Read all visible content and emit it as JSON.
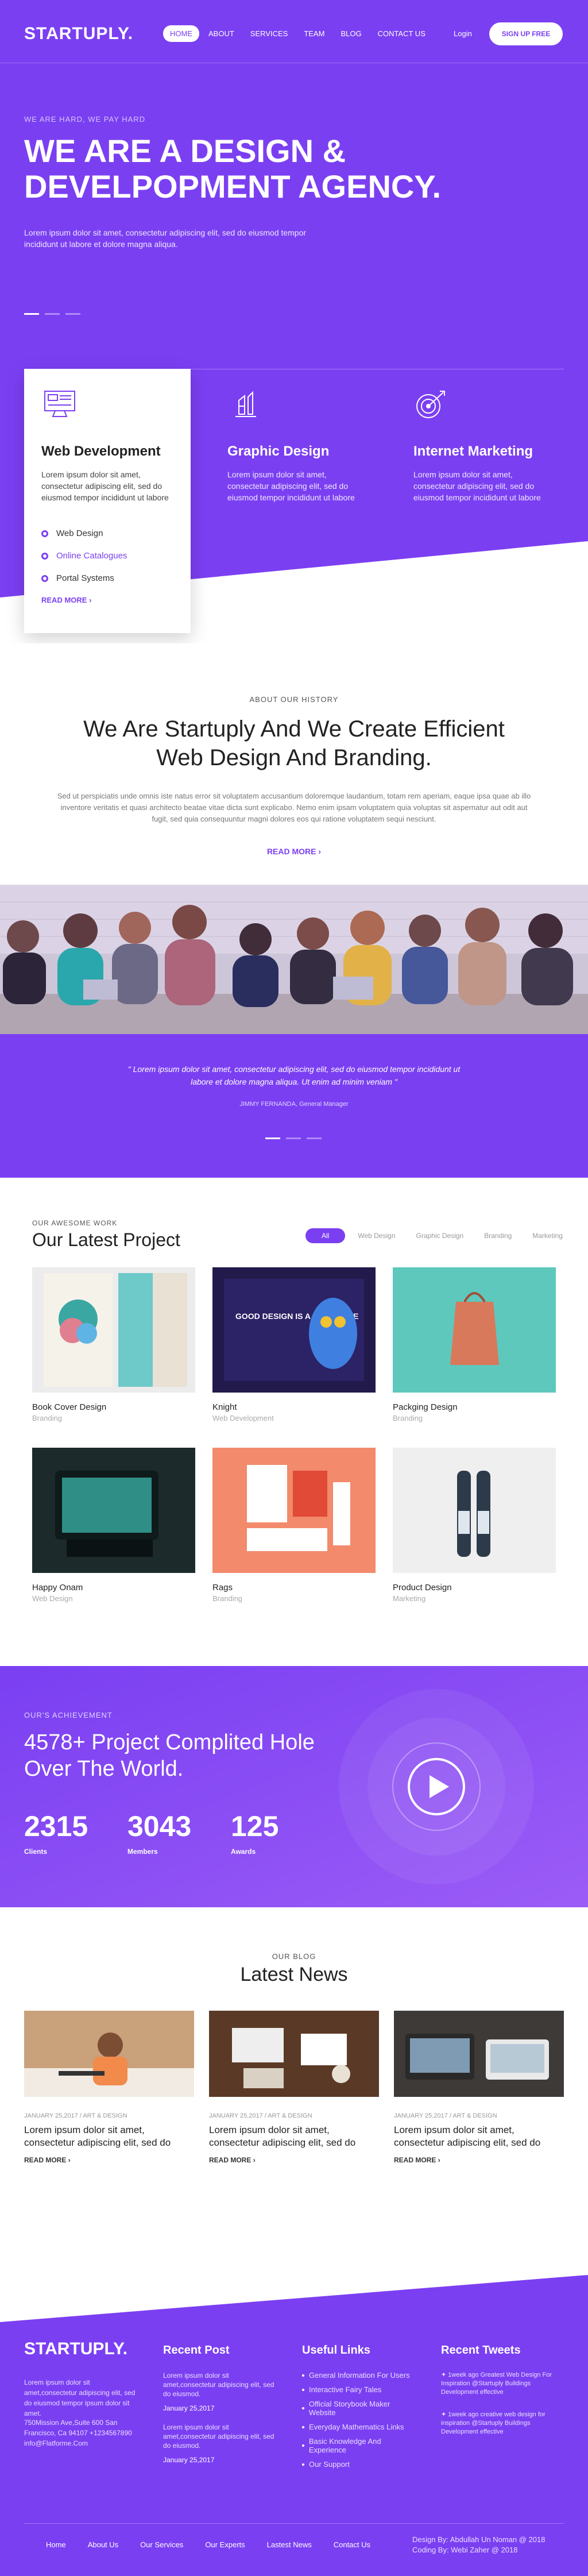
{
  "header": {
    "logo": "STARTUPLY.",
    "nav": [
      "HOME",
      "ABOUT",
      "SERVICES",
      "TEAM",
      "BLOG",
      "CONTACT US"
    ],
    "login": "Login",
    "signup": "SIGN UP FREE"
  },
  "hero": {
    "kicker": "WE ARE HARD, WE PAY HARD",
    "title": "WE ARE A DESIGN & DEVELPOPMENT AGENCY.",
    "lead": "Lorem ipsum dolor sit amet, consectetur adipiscing elit, sed do eiusmod tempor incididunt ut labore et dolore magna aliqua."
  },
  "services": [
    {
      "title": "Web Development",
      "text": "Lorem ipsum dolor sit amet, consectetur adipiscing elit, sed do eiusmod tempor incididunt ut labore",
      "icon": "monitor-code-icon"
    },
    {
      "title": "Graphic Design",
      "text": "Lorem ipsum dolor sit amet, consectetur adipiscing elit, sed do eiusmod tempor incididunt ut labore",
      "icon": "pen-tools-icon"
    },
    {
      "title": "Internet Marketing",
      "text": "Lorem ipsum dolor sit amet, consectetur adipiscing elit, sed do eiusmod tempor incididunt ut labore",
      "icon": "target-icon"
    }
  ],
  "service_list": [
    "Web Design",
    "Online Catalogues",
    "Portal Systems"
  ],
  "service_more": "READ MORE",
  "about": {
    "kicker": "ABOUT OUR HISTORY",
    "title": "We Are Startuply And We Create Efficient Web Design And Branding.",
    "text": "Sed ut perspiciatis unde omnis iste natus error sit voluptatem accusantium doloremque laudantium, totam rem aperiam, eaque ipsa quae ab illo inventore veritatis et quasi architecto beatae vitae dicta sunt explicabo. Nemo enim ipsam voluptatem quia voluptas sit aspernatur aut odit aut fugit, sed quia consequuntur magni dolores eos qui ratione voluptatem sequi nesciunt.",
    "more": "READ MORE"
  },
  "testimonial": {
    "quote": "\" Lorem ipsum dolor sit amet, consectetur adipiscing elit, sed do eiusmod tempor incididunt ut labore et dolore magna aliqua. Ut enim ad minim veniam \"",
    "author": "JIMMY FERNANDA, General Manager"
  },
  "projects": {
    "kicker": "OUR AWESOME WORK",
    "title": "Our Latest Project",
    "filters": [
      "All",
      "Web Design",
      "Graphic Design",
      "Branding",
      "Marketing"
    ],
    "items": [
      {
        "title": "Book Cover Design",
        "tag": "Branding"
      },
      {
        "title": "Knight",
        "tag": "Web Development"
      },
      {
        "title": "Packging Design",
        "tag": "Branding"
      },
      {
        "title": "Happy Onam",
        "tag": "Web Design"
      },
      {
        "title": "Rags",
        "tag": "Branding"
      },
      {
        "title": "Product Design",
        "tag": "Marketing"
      }
    ],
    "knight_card_text": "GOOD DESIGN IS A LANGUAGE"
  },
  "achievement": {
    "kicker": "OUR'S ACHIEVEMENT",
    "title": "4578+ Project Complited Hole Over The World.",
    "stats": [
      {
        "value": "2315",
        "label": "Clients"
      },
      {
        "value": "3043",
        "label": "Members"
      },
      {
        "value": "125",
        "label": "Awards"
      }
    ]
  },
  "blog": {
    "kicker": "OUR BLOG",
    "title": "Latest News",
    "posts": [
      {
        "meta": "JANUARY 25,2017 / ART & DESIGN",
        "title": "Lorem ipsum dolor sit amet, consectetur adipiscing elit, sed do",
        "more": "READ MORE"
      },
      {
        "meta": "JANUARY 25,2017 / ART & DESIGN",
        "title": "Lorem ipsum dolor sit amet, consectetur adipiscing elit, sed do",
        "more": "READ MORE"
      },
      {
        "meta": "JANUARY 25,2017 / ART & DESIGN",
        "title": "Lorem ipsum dolor sit amet, consectetur adipiscing elit, sed do",
        "more": "READ MORE"
      }
    ]
  },
  "footer": {
    "logo": "STARTUPLY.",
    "about": "Lorem ipsum dolor sit amet,consectetur adipiscing elit, sed do eiusmod tempor ipsum dolor sit amet.",
    "address": "750Mission Ave,Suite 600 San Francisco, Ca 94107 +1234567890 info@Flatforme.Com",
    "recent_title": "Recent Post",
    "recent": [
      {
        "text": "Lorem ipsum dolor sit amet,consectetur adipiscing elit, sed do eiusmod.",
        "date": "January 25,2017"
      },
      {
        "text": "Lorem ipsum dolor sit amet,consectetur adipiscing elit, sed do eiusmod.",
        "date": "January 25,2017"
      }
    ],
    "links_title": "Useful Links",
    "links": [
      "General Information For Users",
      "Interactive Fairy Tales",
      "Official Storybook Maker Website",
      "Everyday Mathematics Links",
      "Basic Knowledge And Experience",
      "Our Support"
    ],
    "tweets_title": "Recent Tweets",
    "tweets": [
      {
        "text": "1week ago Greatest Web Design For Inspiration @Startuply Buildings Development effective"
      },
      {
        "text": "1week ago creative web design for inspiration @Startuply Buildings Development effective"
      }
    ],
    "nav": [
      "Home",
      "About Us",
      "Our Services",
      "Our Experts",
      "Lastest News",
      "Contact Us"
    ],
    "credit_line1": "Design By: Abdullah Un Noman @ 2018",
    "credit_line2": "Coding By: Webi Zaher @ 2018"
  }
}
